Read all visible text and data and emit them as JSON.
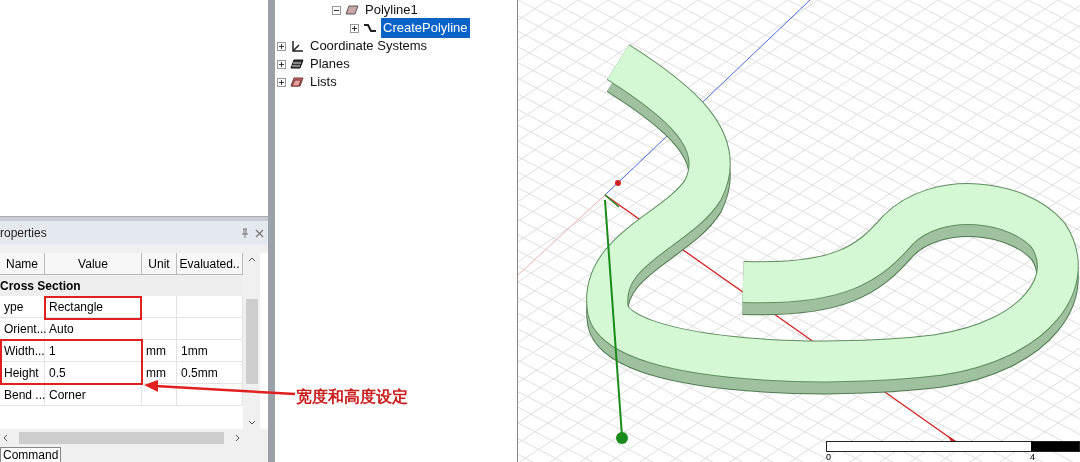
{
  "tree": {
    "items": [
      {
        "label": "Polyline1",
        "kind": "object",
        "expanded": true,
        "selected": false,
        "children": [
          {
            "label": "CreatePolyline",
            "kind": "operation",
            "expanded": false,
            "selected": true
          }
        ]
      },
      {
        "label": "Coordinate Systems",
        "kind": "coordinate-systems",
        "expanded": false,
        "selected": false
      },
      {
        "label": "Planes",
        "kind": "planes",
        "expanded": false,
        "selected": false
      },
      {
        "label": "Lists",
        "kind": "lists",
        "expanded": false,
        "selected": false
      }
    ]
  },
  "properties_panel": {
    "title": "roperties",
    "columns": [
      "Name",
      "Value",
      "Unit",
      "Evaluated.."
    ],
    "group": "Cross Section",
    "rows": [
      {
        "name": "ype",
        "value": "Rectangle"
      },
      {
        "name": "Orient...",
        "value": "Auto"
      },
      {
        "name": "Width...",
        "value": "1",
        "unit": "mm",
        "evaluated": "1mm"
      },
      {
        "name": "Height",
        "value": "0.5",
        "unit": "mm",
        "evaluated": "0.5mm"
      },
      {
        "name": "Bend ...",
        "value": "Corner"
      }
    ],
    "tab": "Command"
  },
  "annotation": {
    "label": "宽度和高度设定"
  },
  "viewport": {
    "scale_bar": {
      "labels": [
        "0",
        "4"
      ]
    }
  }
}
